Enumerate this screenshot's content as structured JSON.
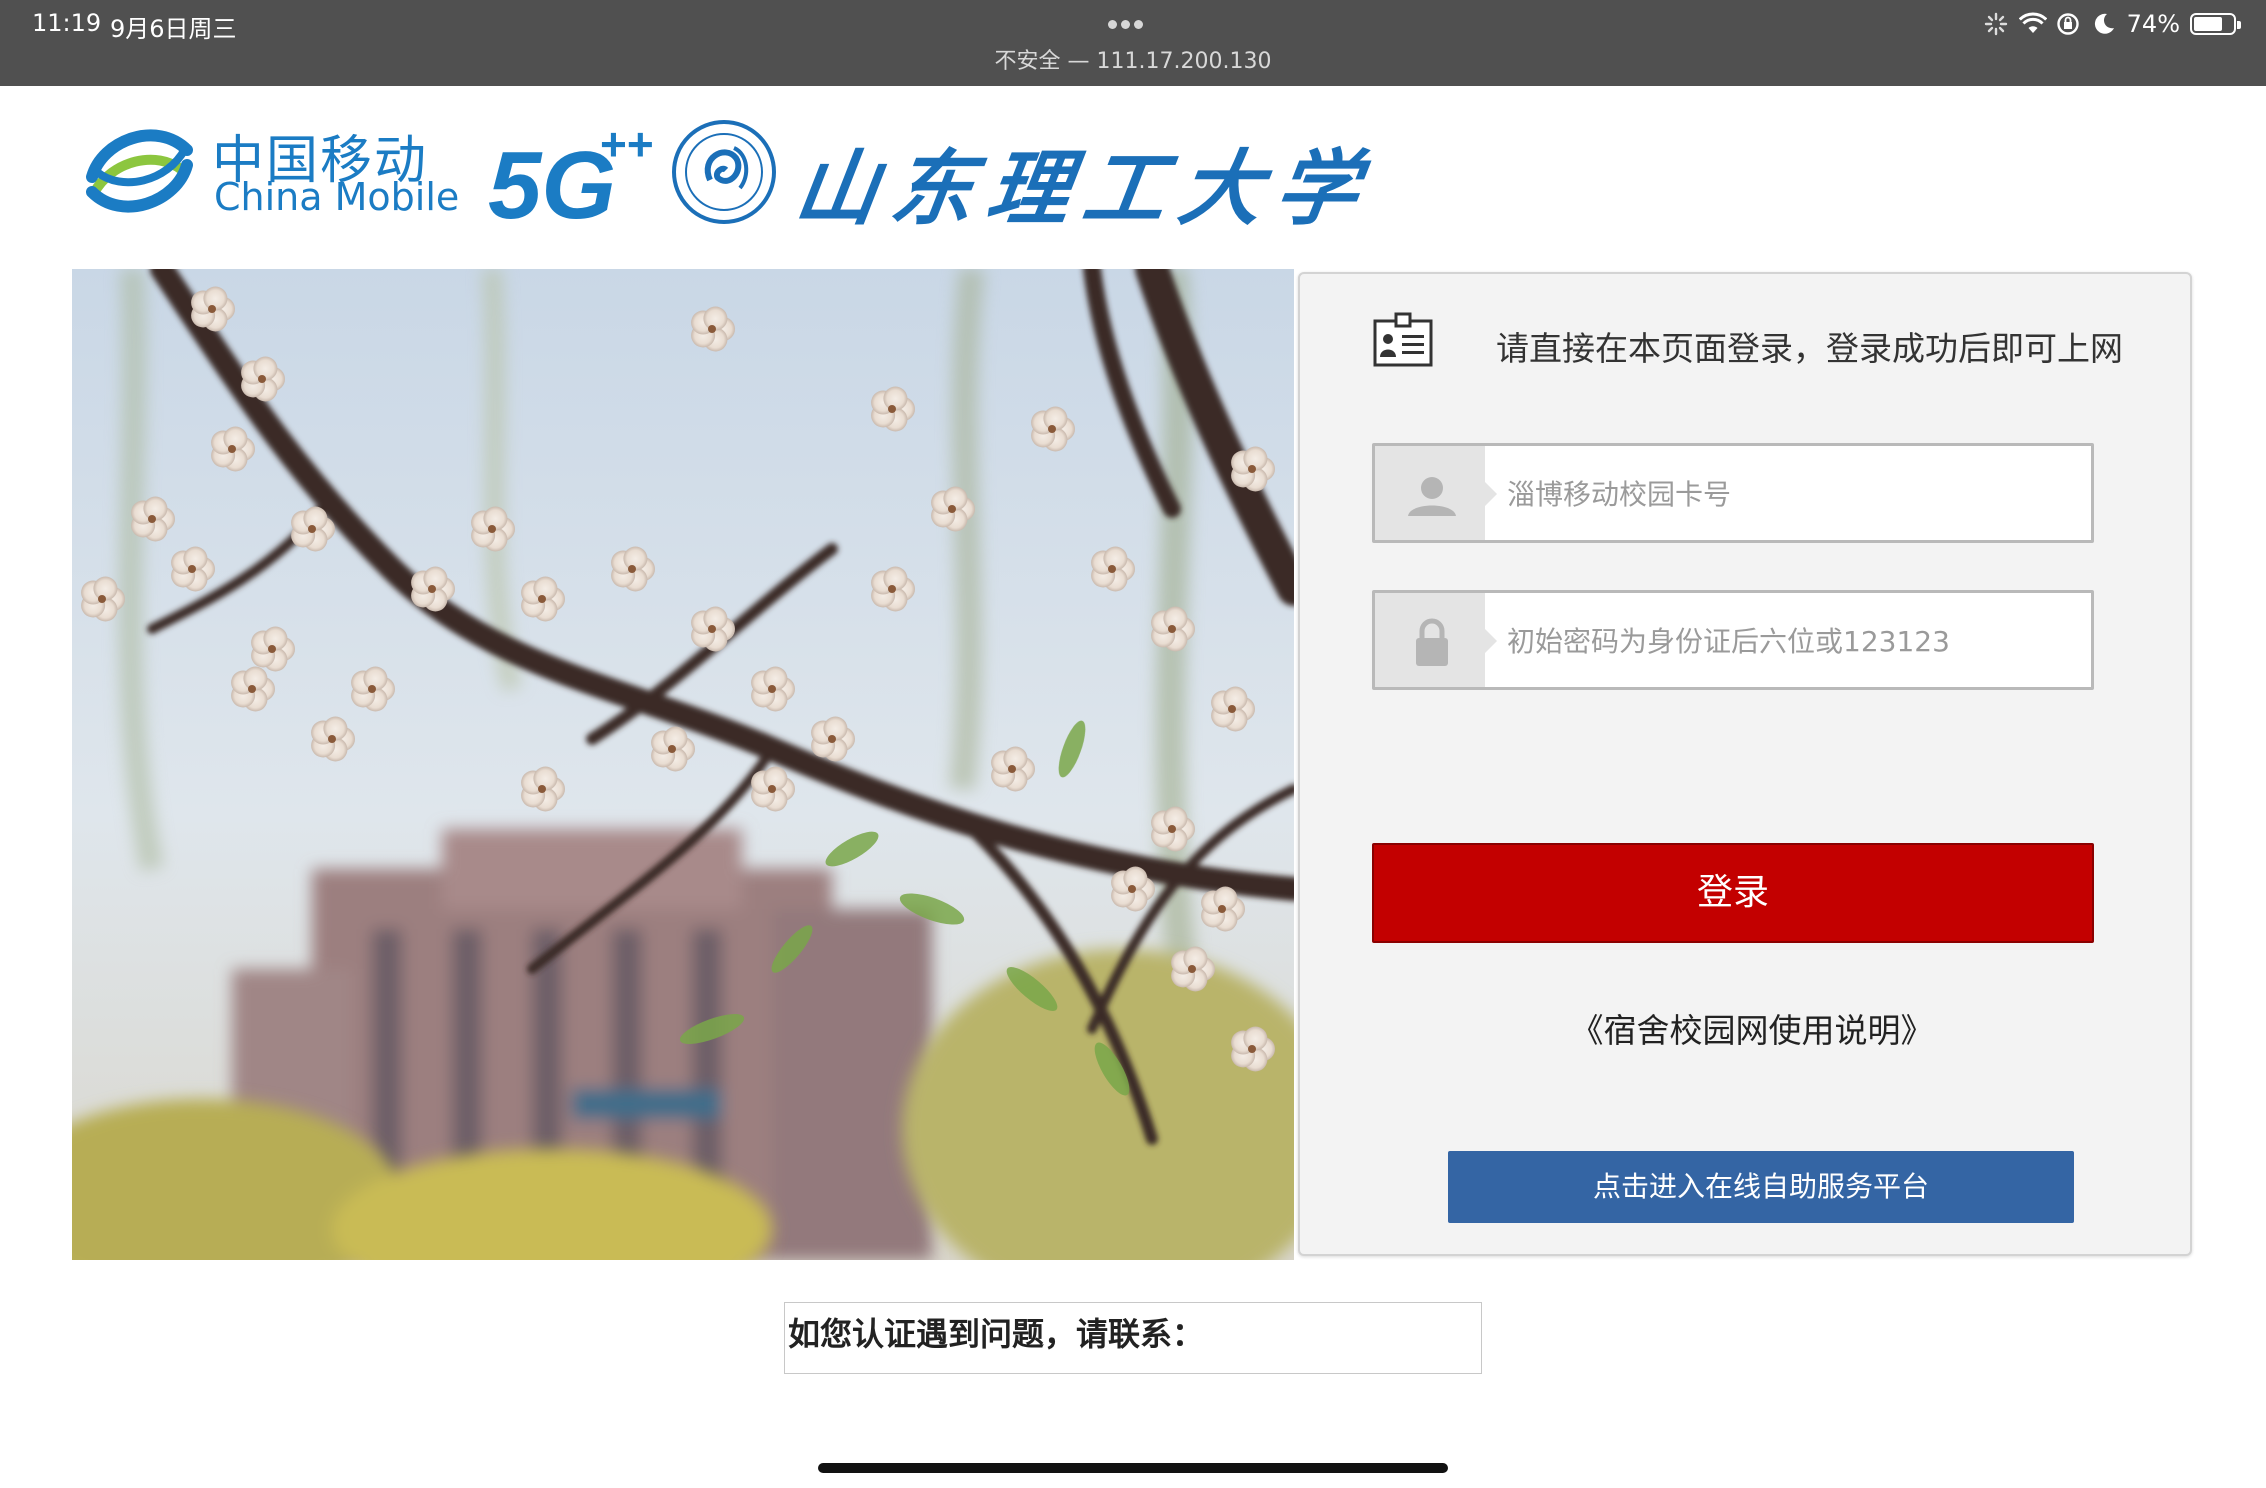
{
  "status_bar": {
    "time": "11:19",
    "date": "9月6日周三",
    "url": "不安全 — 111.17.200.130",
    "battery_percent_label": "74%",
    "battery_level": 0.74
  },
  "header": {
    "cm_chinese": "中国移动",
    "cm_english": "China Mobile",
    "university_name": "山东理工大学"
  },
  "login": {
    "message": "请直接在本页面登录，登录成功后即可上网",
    "username_placeholder": "淄博移动校园卡号",
    "password_placeholder": "初始密码为身份证后六位或123123",
    "login_label": "登录",
    "guide_link": "《宿舍校园网使用说明》",
    "service_label": "点击进入在线自助服务平台"
  },
  "contact": {
    "text": "如您认证遇到问题，请联系："
  },
  "colors": {
    "login_red": "#c30000",
    "service_blue": "#3465a4",
    "brand_blue": "#1b7cc4"
  }
}
